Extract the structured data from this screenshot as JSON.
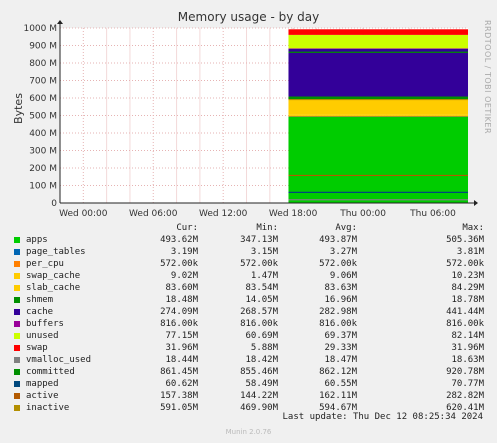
{
  "title": "Memory usage - by day",
  "side_label": "RRDTOOL / TOBI OETIKER",
  "footer": "Last update: Thu Dec 12 08:25:34 2024",
  "generator": "Munin 2.0.76",
  "columns": [
    "Cur:",
    "Min:",
    "Avg:",
    "Max:"
  ],
  "chart_data": {
    "type": "area",
    "title": "Memory usage - by day",
    "ylabel": "Bytes",
    "ylim": [
      0,
      1000
    ],
    "yunit": "M",
    "yticks": [
      "0",
      "100 M",
      "200 M",
      "300 M",
      "400 M",
      "500 M",
      "600 M",
      "700 M",
      "800 M",
      "900 M",
      "1000 M"
    ],
    "xticks": [
      "Wed 00:00",
      "Wed 06:00",
      "Wed 12:00",
      "Wed 18:00",
      "Thu 00:00",
      "Thu 06:00"
    ],
    "x_range_hours": [
      -2,
      33
    ],
    "data_start_hour": 17.6,
    "grid": true,
    "legend_position": "bottom",
    "series": [
      {
        "name": "apps",
        "color": "#00cc00",
        "cur": "493.62M",
        "min": "347.13M",
        "avg": "493.87M",
        "max": "505.36M",
        "stack_mb": 493.6
      },
      {
        "name": "page_tables",
        "color": "#0066b3",
        "cur": "3.19M",
        "min": "3.15M",
        "avg": "3.27M",
        "max": "3.81M",
        "stack_mb": 3.2
      },
      {
        "name": "per_cpu",
        "color": "#ff8000",
        "cur": "572.00k",
        "min": "572.00k",
        "avg": "572.00k",
        "max": "572.00k",
        "stack_mb": 0.6
      },
      {
        "name": "swap_cache",
        "color": "#ffcc00",
        "cur": "9.02M",
        "min": "1.47M",
        "avg": "9.06M",
        "max": "10.23M",
        "stack_mb": 9.0
      },
      {
        "name": "slab_cache",
        "color": "#ffcc00",
        "cur": "83.60M",
        "min": "83.54M",
        "avg": "83.63M",
        "max": "84.29M",
        "stack_mb": 83.6
      },
      {
        "name": "shmem",
        "color": "#008f00",
        "cur": "18.48M",
        "min": "14.05M",
        "avg": "16.96M",
        "max": "18.78M",
        "stack_mb": 18.5
      },
      {
        "name": "cache",
        "color": "#330099",
        "cur": "274.09M",
        "min": "268.57M",
        "avg": "282.98M",
        "max": "441.44M",
        "stack_mb": 274.1
      },
      {
        "name": "buffers",
        "color": "#990099",
        "cur": "816.00k",
        "min": "816.00k",
        "avg": "816.00k",
        "max": "816.00k",
        "stack_mb": 0.8
      },
      {
        "name": "unused",
        "color": "#ccff00",
        "cur": "77.15M",
        "min": "60.69M",
        "avg": "69.37M",
        "max": "82.14M",
        "stack_mb": 77.2
      },
      {
        "name": "swap",
        "color": "#ff0000",
        "cur": "31.96M",
        "min": "5.88M",
        "avg": "29.33M",
        "max": "31.96M",
        "stack_mb": 32.0
      },
      {
        "name": "vmalloc_used",
        "color": "#808080",
        "cur": "18.44M",
        "min": "18.42M",
        "avg": "18.47M",
        "max": "18.63M",
        "line_mb": 18.4
      },
      {
        "name": "committed",
        "color": "#008f00",
        "cur": "861.45M",
        "min": "855.46M",
        "avg": "862.12M",
        "max": "920.78M",
        "line_mb": 861.5
      },
      {
        "name": "mapped",
        "color": "#00487d",
        "cur": "60.62M",
        "min": "58.49M",
        "avg": "60.55M",
        "max": "70.77M",
        "line_mb": 60.6
      },
      {
        "name": "active",
        "color": "#b35a00",
        "cur": "157.38M",
        "min": "144.22M",
        "avg": "162.11M",
        "max": "282.82M",
        "line_mb": 157.4
      },
      {
        "name": "inactive",
        "color": "#b38f00",
        "cur": "591.05M",
        "min": "469.90M",
        "avg": "594.67M",
        "max": "620.41M",
        "line_mb": 591.1
      }
    ]
  }
}
